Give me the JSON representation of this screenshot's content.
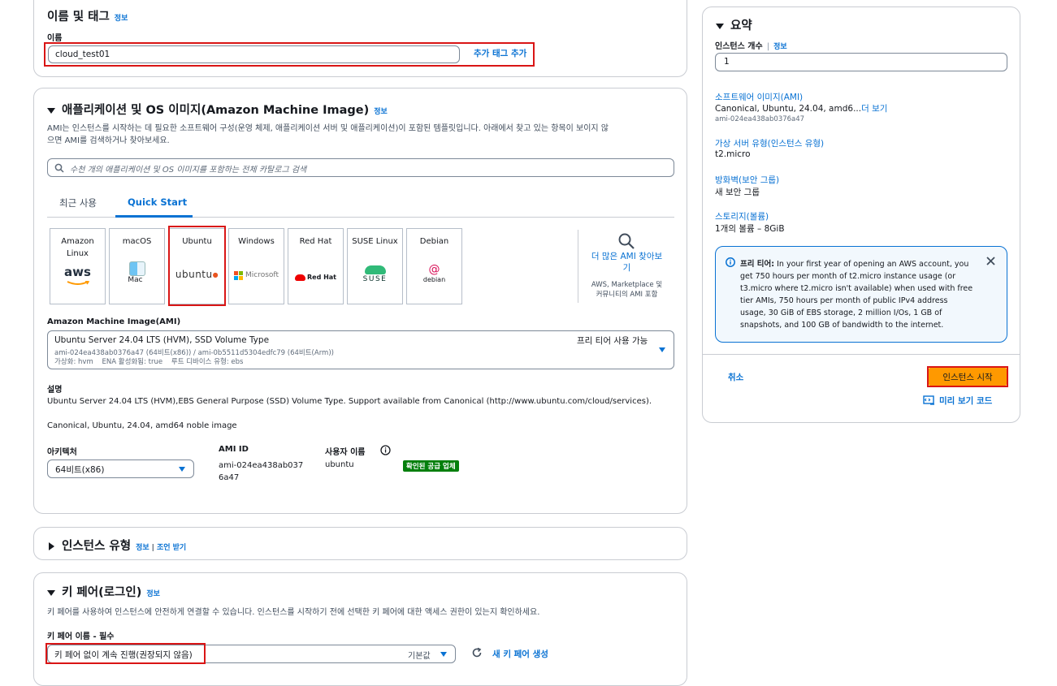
{
  "name_tags": {
    "title": "이름 및 태그",
    "info": "정보",
    "name_label": "이름",
    "name_value": "cloud_test01",
    "add_tags": "추가 태그 추가"
  },
  "ami": {
    "title": "애플리케이션 및 OS 이미지(Amazon Machine Image)",
    "info": "정보",
    "description_line1": "AMI는 인스턴스를 시작하는 데 필요한 소프트웨어 구성(운영 체제, 애플리케이션 서버 및 애플리케이션)이 포함된 템플릿입니다. 아래에서 찾고 있는 항목이 보이지 않",
    "description_line2": "으면 AMI를 검색하거나 찾아보세요.",
    "search_placeholder": "수천 개의 애플리케이션 및 OS 이미지를 포함하는 전체 카탈로그 검색",
    "tabs": [
      {
        "label": "최근 사용"
      },
      {
        "label": "Quick Start"
      }
    ],
    "os_cards": [
      {
        "label": "Amazon Linux",
        "logo": "aws"
      },
      {
        "label": "macOS",
        "logo": "Mac"
      },
      {
        "label": "Ubuntu",
        "logo": "ubuntu"
      },
      {
        "label": "Windows",
        "logo": "Microsoft"
      },
      {
        "label": "Red Hat",
        "logo": "Red Hat"
      },
      {
        "label": "SUSE Linux",
        "logo": "SUSE"
      },
      {
        "label": "Debian",
        "logo": "debian"
      }
    ],
    "browse_more": "더 많은 AMI 찾아보기",
    "browse_sub": "AWS, Marketplace 및 커뮤니티의 AMI 포함",
    "ami_label": "Amazon Machine Image(AMI)",
    "ami_name": "Ubuntu Server 24.04 LTS (HVM), SSD Volume Type",
    "ami_ids": "ami-024ea438ab0376a47 (64비트(x86)) / ami-0b5511d5304edfc79 (64비트(Arm))",
    "ami_meta": "가상화: hvm    ENA 활성화됨: true    루트 디바이스 유형: ebs",
    "free_tier": "프리 티어 사용 가능",
    "desc_label": "설명",
    "desc_text": "Ubuntu Server 24.04 LTS (HVM),EBS General Purpose (SSD) Volume Type. Support available from Canonical (http://www.ubuntu.com/cloud/services).",
    "desc_text2": "Canonical, Ubuntu, 24.04, amd64 noble image",
    "arch_label": "아키텍처",
    "arch_value": "64비트(x86)",
    "ami_id_label": "AMI ID",
    "ami_id_value": "ami-024ea438ab0376a47",
    "username_label": "사용자 이름",
    "username_value": "ubuntu",
    "verified_badge": "확인된 공급 업체"
  },
  "instance_type": {
    "title": "인스턴스 유형",
    "info": "정보",
    "advice": "조언 받기"
  },
  "key_pair": {
    "title": "키 페어(로그인)",
    "info": "정보",
    "description": "키 페어를 사용하여 인스턴스에 안전하게 연결할 수 있습니다. 인스턴스를 시작하기 전에 선택한 키 페어에 대한 액세스 권한이 있는지 확인하세요.",
    "name_label": "키 페어 이름 - 필수",
    "value": "키 페어 없이 계속 진행(권장되지 않음)",
    "default_tag": "기본값",
    "create_new": "새 키 페어 생성"
  },
  "summary": {
    "title": "요약",
    "count_label": "인스턴스 개수",
    "info": "정보",
    "count_value": "1",
    "software_label": "소프트웨어 이미지(AMI)",
    "software_value": "Canonical, Ubuntu, 24.04, amd6...",
    "software_more": "더 보기",
    "software_id": "ami-024ea438ab0376a47",
    "server_type_label": "가상 서버 유형(인스턴스 유형)",
    "server_type_value": "t2.micro",
    "firewall_label": "방화벽(보안 그룹)",
    "firewall_value": "새 보안 그룹",
    "storage_label": "스토리지(볼륨)",
    "storage_value": "1개의 볼륨 – 8GiB",
    "free_tier_title": "프리 티어:",
    "free_tier_lines": [
      "In your first year of opening an AWS account, you",
      "get 750 hours per month of t2.micro instance usage (or",
      "t3.micro where t2.micro isn't available) when used with free",
      "tier AMIs, 750 hours per month of public IPv4 address",
      "usage, 30 GiB of EBS storage, 2 million I/Os, 1 GB of",
      "snapshots, and 100 GB of bandwidth to the internet."
    ],
    "cancel": "취소",
    "launch": "인스턴스 시작",
    "preview_code": "미리 보기 코드"
  },
  "colors": {
    "link": "#0972d3",
    "launch_button": "#ff9900",
    "highlight_box": "#d91515",
    "badge_green": "#037f0c"
  }
}
